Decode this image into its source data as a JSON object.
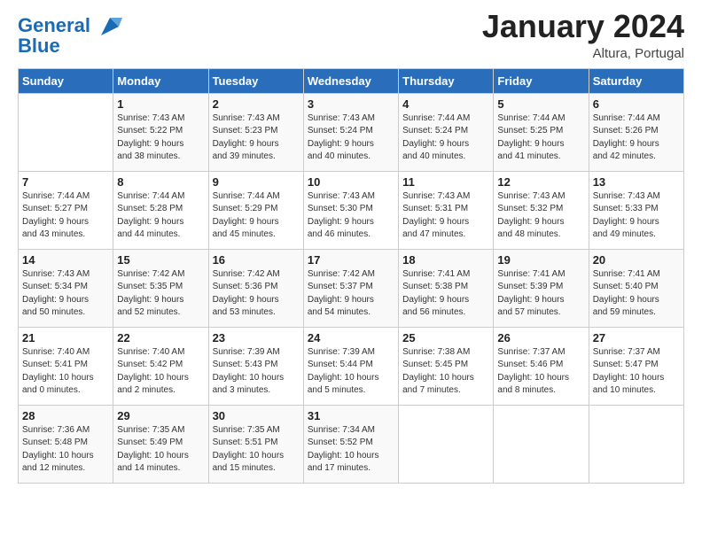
{
  "header": {
    "logo_line1": "General",
    "logo_line2": "Blue",
    "month_year": "January 2024",
    "location": "Altura, Portugal"
  },
  "days_of_week": [
    "Sunday",
    "Monday",
    "Tuesday",
    "Wednesday",
    "Thursday",
    "Friday",
    "Saturday"
  ],
  "weeks": [
    [
      {
        "day": "",
        "info": ""
      },
      {
        "day": "1",
        "info": "Sunrise: 7:43 AM\nSunset: 5:22 PM\nDaylight: 9 hours\nand 38 minutes."
      },
      {
        "day": "2",
        "info": "Sunrise: 7:43 AM\nSunset: 5:23 PM\nDaylight: 9 hours\nand 39 minutes."
      },
      {
        "day": "3",
        "info": "Sunrise: 7:43 AM\nSunset: 5:24 PM\nDaylight: 9 hours\nand 40 minutes."
      },
      {
        "day": "4",
        "info": "Sunrise: 7:44 AM\nSunset: 5:24 PM\nDaylight: 9 hours\nand 40 minutes."
      },
      {
        "day": "5",
        "info": "Sunrise: 7:44 AM\nSunset: 5:25 PM\nDaylight: 9 hours\nand 41 minutes."
      },
      {
        "day": "6",
        "info": "Sunrise: 7:44 AM\nSunset: 5:26 PM\nDaylight: 9 hours\nand 42 minutes."
      }
    ],
    [
      {
        "day": "7",
        "info": "Sunrise: 7:44 AM\nSunset: 5:27 PM\nDaylight: 9 hours\nand 43 minutes."
      },
      {
        "day": "8",
        "info": "Sunrise: 7:44 AM\nSunset: 5:28 PM\nDaylight: 9 hours\nand 44 minutes."
      },
      {
        "day": "9",
        "info": "Sunrise: 7:44 AM\nSunset: 5:29 PM\nDaylight: 9 hours\nand 45 minutes."
      },
      {
        "day": "10",
        "info": "Sunrise: 7:43 AM\nSunset: 5:30 PM\nDaylight: 9 hours\nand 46 minutes."
      },
      {
        "day": "11",
        "info": "Sunrise: 7:43 AM\nSunset: 5:31 PM\nDaylight: 9 hours\nand 47 minutes."
      },
      {
        "day": "12",
        "info": "Sunrise: 7:43 AM\nSunset: 5:32 PM\nDaylight: 9 hours\nand 48 minutes."
      },
      {
        "day": "13",
        "info": "Sunrise: 7:43 AM\nSunset: 5:33 PM\nDaylight: 9 hours\nand 49 minutes."
      }
    ],
    [
      {
        "day": "14",
        "info": "Sunrise: 7:43 AM\nSunset: 5:34 PM\nDaylight: 9 hours\nand 50 minutes."
      },
      {
        "day": "15",
        "info": "Sunrise: 7:42 AM\nSunset: 5:35 PM\nDaylight: 9 hours\nand 52 minutes."
      },
      {
        "day": "16",
        "info": "Sunrise: 7:42 AM\nSunset: 5:36 PM\nDaylight: 9 hours\nand 53 minutes."
      },
      {
        "day": "17",
        "info": "Sunrise: 7:42 AM\nSunset: 5:37 PM\nDaylight: 9 hours\nand 54 minutes."
      },
      {
        "day": "18",
        "info": "Sunrise: 7:41 AM\nSunset: 5:38 PM\nDaylight: 9 hours\nand 56 minutes."
      },
      {
        "day": "19",
        "info": "Sunrise: 7:41 AM\nSunset: 5:39 PM\nDaylight: 9 hours\nand 57 minutes."
      },
      {
        "day": "20",
        "info": "Sunrise: 7:41 AM\nSunset: 5:40 PM\nDaylight: 9 hours\nand 59 minutes."
      }
    ],
    [
      {
        "day": "21",
        "info": "Sunrise: 7:40 AM\nSunset: 5:41 PM\nDaylight: 10 hours\nand 0 minutes."
      },
      {
        "day": "22",
        "info": "Sunrise: 7:40 AM\nSunset: 5:42 PM\nDaylight: 10 hours\nand 2 minutes."
      },
      {
        "day": "23",
        "info": "Sunrise: 7:39 AM\nSunset: 5:43 PM\nDaylight: 10 hours\nand 3 minutes."
      },
      {
        "day": "24",
        "info": "Sunrise: 7:39 AM\nSunset: 5:44 PM\nDaylight: 10 hours\nand 5 minutes."
      },
      {
        "day": "25",
        "info": "Sunrise: 7:38 AM\nSunset: 5:45 PM\nDaylight: 10 hours\nand 7 minutes."
      },
      {
        "day": "26",
        "info": "Sunrise: 7:37 AM\nSunset: 5:46 PM\nDaylight: 10 hours\nand 8 minutes."
      },
      {
        "day": "27",
        "info": "Sunrise: 7:37 AM\nSunset: 5:47 PM\nDaylight: 10 hours\nand 10 minutes."
      }
    ],
    [
      {
        "day": "28",
        "info": "Sunrise: 7:36 AM\nSunset: 5:48 PM\nDaylight: 10 hours\nand 12 minutes."
      },
      {
        "day": "29",
        "info": "Sunrise: 7:35 AM\nSunset: 5:49 PM\nDaylight: 10 hours\nand 14 minutes."
      },
      {
        "day": "30",
        "info": "Sunrise: 7:35 AM\nSunset: 5:51 PM\nDaylight: 10 hours\nand 15 minutes."
      },
      {
        "day": "31",
        "info": "Sunrise: 7:34 AM\nSunset: 5:52 PM\nDaylight: 10 hours\nand 17 minutes."
      },
      {
        "day": "",
        "info": ""
      },
      {
        "day": "",
        "info": ""
      },
      {
        "day": "",
        "info": ""
      }
    ]
  ]
}
